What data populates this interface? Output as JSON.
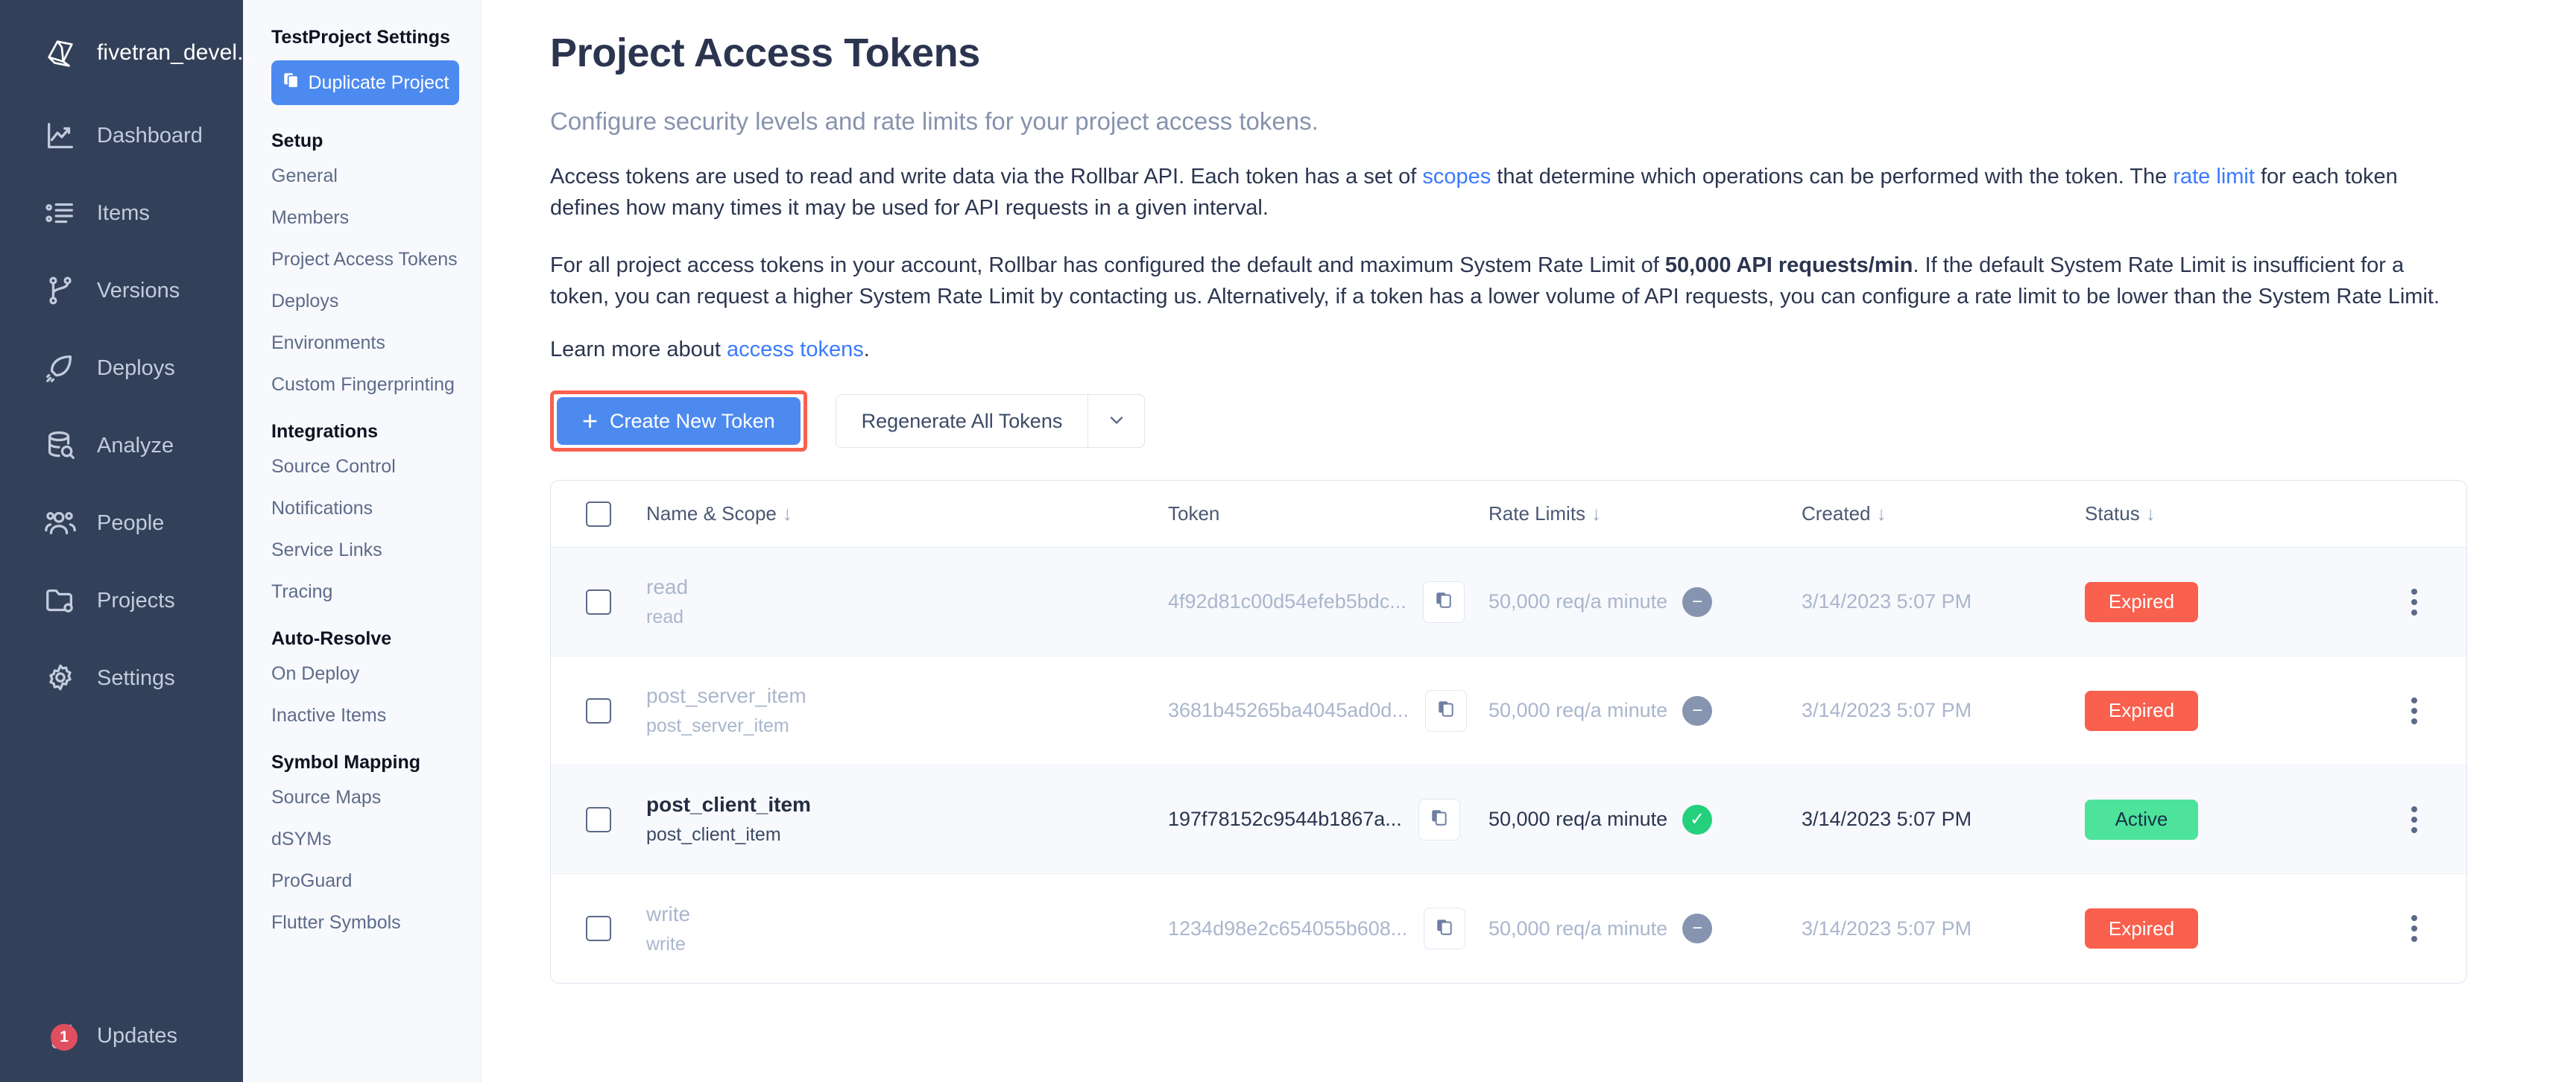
{
  "railbar": {
    "brand": {
      "label": "fivetran_devel...",
      "icon": "cube-logo-icon"
    },
    "items": [
      {
        "label": "Dashboard",
        "icon": "chart-line-icon"
      },
      {
        "label": "Items",
        "icon": "list-bullet-icon"
      },
      {
        "label": "Versions",
        "icon": "git-branch-icon"
      },
      {
        "label": "Deploys",
        "icon": "rocket-icon"
      },
      {
        "label": "Analyze",
        "icon": "database-search-icon"
      },
      {
        "label": "People",
        "icon": "people-icon"
      },
      {
        "label": "Projects",
        "icon": "folder-gear-icon"
      },
      {
        "label": "Settings",
        "icon": "gear-icon"
      }
    ],
    "updates": {
      "label": "Updates",
      "icon": "megaphone-icon",
      "badge": "1"
    }
  },
  "subnav": {
    "title": "TestProject Settings",
    "duplicate_button": {
      "label": "Duplicate Project",
      "icon": "copy-icon"
    },
    "groups": [
      {
        "title": "Setup",
        "links": [
          "General",
          "Members",
          "Project Access Tokens",
          "Deploys",
          "Environments",
          "Custom Fingerprinting"
        ]
      },
      {
        "title": "Integrations",
        "links": [
          "Source Control",
          "Notifications",
          "Service Links",
          "Tracing"
        ]
      },
      {
        "title": "Auto-Resolve",
        "links": [
          "On Deploy",
          "Inactive Items"
        ]
      },
      {
        "title": "Symbol Mapping",
        "links": [
          "Source Maps",
          "dSYMs",
          "ProGuard",
          "Flutter Symbols"
        ]
      }
    ]
  },
  "main": {
    "title": "Project Access Tokens",
    "subtitle": "Configure security levels and rate limits for your project access tokens.",
    "paragraph1": {
      "part1": "Access tokens are used to read and write data via the Rollbar API. Each token has a set of ",
      "link1": "scopes",
      "part2": " that determine which operations can be performed with the token. The ",
      "link2": "rate limit",
      "part3": " for each token defines how many times it may be used for API requests in a given interval."
    },
    "paragraph2": {
      "part1": "For all project access tokens in your account, Rollbar has configured the default and maximum System Rate Limit of ",
      "bold1": "50,000 API requests/min",
      "part2": ". If the default System Rate Limit is insufficient for a token, you can request a higher System Rate Limit by contacting us. Alternatively, if a token has a lower volume of API requests, you can configure a rate limit to be lower than the System Rate Limit."
    },
    "learn_more": {
      "prefix": "Learn more about ",
      "link": "access tokens",
      "suffix": "."
    },
    "create_token_button": {
      "label": "Create New Token",
      "icon": "plus-icon"
    },
    "regenerate_button": {
      "label": "Regenerate All Tokens",
      "caret_icon": "chevron-down-icon"
    }
  },
  "table": {
    "columns": [
      {
        "label": "Name & Scope",
        "sortable": true,
        "sort_icon": "arrow-down-icon"
      },
      {
        "label": "Token",
        "sortable": false
      },
      {
        "label": "Rate Limits",
        "sortable": true,
        "sort_icon": "arrow-down-icon"
      },
      {
        "label": "Created",
        "sortable": true,
        "sort_icon": "arrow-down-icon"
      },
      {
        "label": "Status",
        "sortable": true,
        "sort_icon": "arrow-down-icon"
      }
    ],
    "rows": [
      {
        "name": "read",
        "scope": "read",
        "token": "4f92d81c00d54efeb5bdc...",
        "rate_limit": "50,000 req/a minute",
        "rate_state": "off",
        "created": "3/14/2023 5:07 PM",
        "status": "Expired",
        "status_kind": "expired",
        "dimmed": true,
        "shade": "alt"
      },
      {
        "name": "post_server_item",
        "scope": "post_server_item",
        "token": "3681b45265ba4045ad0d...",
        "rate_limit": "50,000 req/a minute",
        "rate_state": "off",
        "created": "3/14/2023 5:07 PM",
        "status": "Expired",
        "status_kind": "expired",
        "dimmed": true,
        "shade": "plain"
      },
      {
        "name": "post_client_item",
        "scope": "post_client_item",
        "token": "197f78152c9544b1867a...",
        "rate_limit": "50,000 req/a minute",
        "rate_state": "on",
        "created": "3/14/2023 5:07 PM",
        "status": "Active",
        "status_kind": "active",
        "dimmed": false,
        "shade": "alt"
      },
      {
        "name": "write",
        "scope": "write",
        "token": "1234d98e2c654055b608...",
        "rate_limit": "50,000 req/a minute",
        "rate_state": "off",
        "created": "3/14/2023 5:07 PM",
        "status": "Expired",
        "status_kind": "expired",
        "dimmed": true,
        "shade": "plain"
      }
    ],
    "select_all_checkbox": "select-all",
    "row_menu_icon": "kebab-menu-icon",
    "copy_icon": "copy-icon"
  },
  "colors": {
    "sidebar_bg": "#334059",
    "accent_blue": "#4d8af0",
    "link_blue": "#3a7afe",
    "danger_red": "#f9604e",
    "success_green": "#4ee39b",
    "highlight_outline": "#f9604e"
  }
}
